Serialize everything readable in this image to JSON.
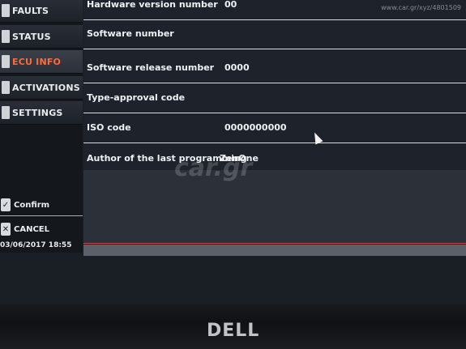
{
  "sidebar": {
    "items": [
      {
        "label": "FAULTS",
        "icon": "warning-icon"
      },
      {
        "label": "STATUS",
        "icon": "status-icon"
      },
      {
        "label": "ECU INFO",
        "icon": "ecu-info-icon",
        "active": true
      },
      {
        "label": "ACTIVATIONS",
        "icon": "activations-icon"
      },
      {
        "label": "SETTINGS",
        "icon": "settings-icon"
      }
    ],
    "actions": [
      {
        "label": "Confirm",
        "icon": "check-icon"
      },
      {
        "label": "CANCEL",
        "icon": "cancel-icon"
      }
    ],
    "datetime": "03/06/2017  18:55"
  },
  "ecu_info": {
    "rows": [
      {
        "key": "Hardware version number",
        "value": "00"
      },
      {
        "key": "Software number",
        "value": ""
      },
      {
        "key": "Software release number",
        "value": "0000"
      },
      {
        "key": "Type-approval code",
        "value": ""
      },
      {
        "key": "ISO code",
        "value": "0000000000"
      },
      {
        "key": "Author of the last programming",
        "value": "ZenOne"
      }
    ]
  },
  "watermark": "car.gr",
  "top_watermark": "www.car.gr/xyz/4801509",
  "bezel_brand": "DELL",
  "colors": {
    "active": "#ff6a3d",
    "text": "#eef1f4",
    "background": "#1e232b"
  }
}
